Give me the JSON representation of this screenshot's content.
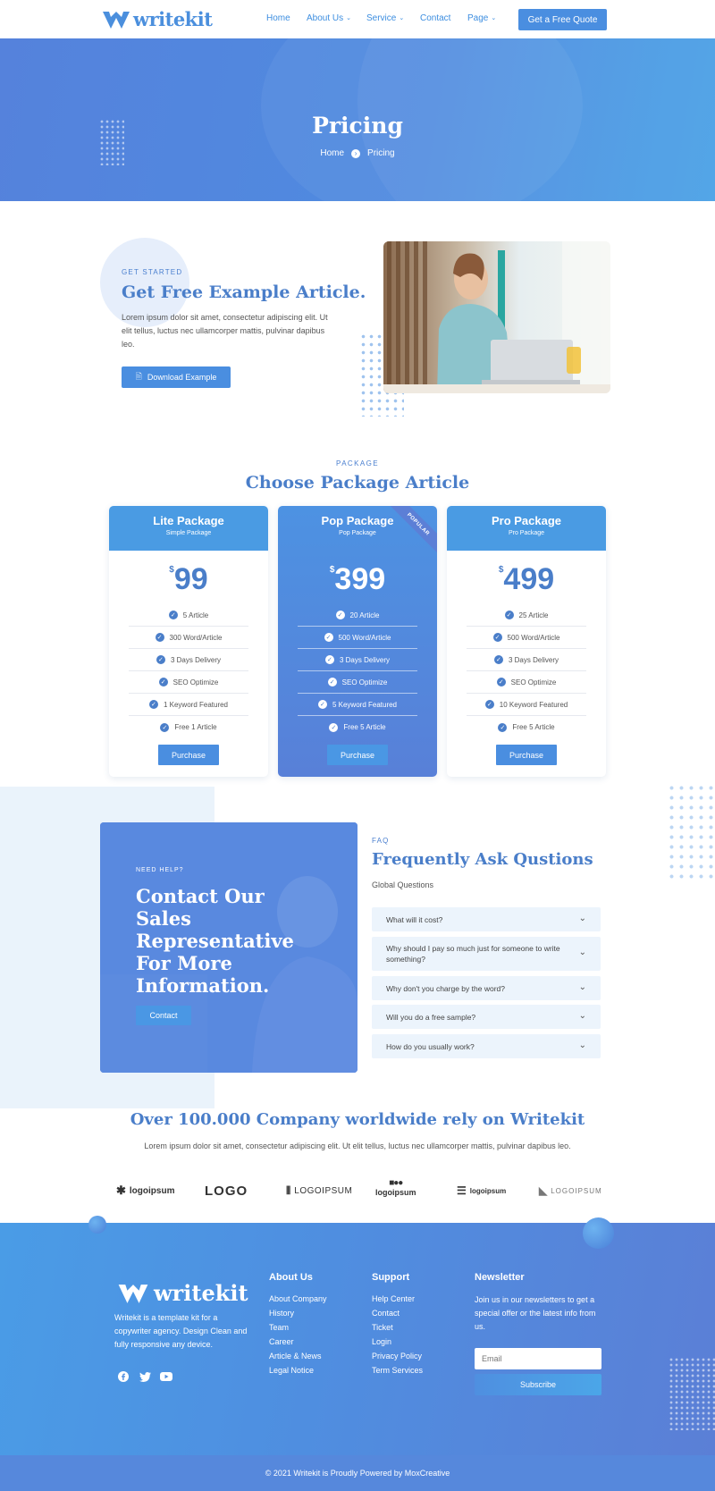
{
  "header": {
    "logo_text": "writekit",
    "nav": [
      {
        "label": "Home",
        "has_dropdown": false
      },
      {
        "label": "About Us",
        "has_dropdown": true
      },
      {
        "label": "Service",
        "has_dropdown": true
      },
      {
        "label": "Contact",
        "has_dropdown": false
      },
      {
        "label": "Page",
        "has_dropdown": true
      }
    ],
    "cta_label": "Get a Free Quote"
  },
  "hero": {
    "title": "Pricing",
    "breadcrumb": [
      "Home",
      "Pricing"
    ]
  },
  "get_started": {
    "eyebrow": "GET STARTED",
    "title": "Get Free Example Article.",
    "body": "Lorem ipsum dolor sit amet, consectetur adipiscing elit. Ut elit tellus, luctus nec ullamcorper mattis, pulvinar dapibus leo.",
    "button_label": "Download Example"
  },
  "packages": {
    "eyebrow": "PACKAGE",
    "title": "Choose Package Article",
    "currency": "$",
    "purchase_label": "Purchase",
    "popular_badge": "POPULAR",
    "items": [
      {
        "name": "Lite Package",
        "sub": "Simple Package",
        "price": "99",
        "features": [
          "5 Article",
          "300 Word/Article",
          "3 Days Delivery",
          "SEO Optimize",
          "1 Keyword Featured",
          "Free 1 Article"
        ]
      },
      {
        "name": "Pop Package",
        "sub": "Pop Package",
        "price": "399",
        "features": [
          "20 Article",
          "500 Word/Article",
          "3 Days Delivery",
          "SEO Optimize",
          "5 Keyword Featured",
          "Free 5 Article"
        ]
      },
      {
        "name": "Pro Package",
        "sub": "Pro Package",
        "price": "499",
        "features": [
          "25 Article",
          "500 Word/Article",
          "3 Days Delivery",
          "SEO Optimize",
          "10 Keyword Featured",
          "Free 5 Article"
        ]
      }
    ]
  },
  "contact": {
    "eyebrow": "NEED HELP?",
    "title": "Contact Our Sales Representative For More Information.",
    "button_label": "Contact"
  },
  "faq": {
    "eyebrow": "FAQ",
    "title": "Frequently Ask Qustions",
    "subtitle": "Global Questions",
    "items": [
      "What will it cost?",
      "Why should I pay so much just for someone to write something?",
      "Why don't you charge by the word?",
      "Will you do a free sample?",
      "How do you usually work?"
    ]
  },
  "companies": {
    "title": "Over 100.000 Company worldwide rely on Writekit",
    "body": "Lorem ipsum dolor sit amet, consectetur adipiscing elit. Ut elit tellus, luctus nec ullamcorper mattis, pulvinar dapibus leo.",
    "logos": [
      "logoipsum",
      "LOGO",
      "LOGOIPSUM",
      "logoipsum",
      "logoipsum",
      "LOGOIPSUM"
    ]
  },
  "footer": {
    "logo_text": "writekit",
    "description": "Writekit is a template kit for a copywriter agency. Design Clean and fully responsive any device.",
    "about_title": "About Us",
    "about_links": [
      "About Company",
      "History",
      "Team",
      "Career",
      "Article & News",
      "Legal Notice"
    ],
    "support_title": "Support",
    "support_links": [
      "Help Center",
      "Contact",
      "Ticket",
      "Login",
      "Privacy Policy",
      "Term Services"
    ],
    "newsletter_title": "Newsletter",
    "newsletter_text": "Join us in our newsletters to get a special offer or the latest info from us.",
    "email_placeholder": "Email",
    "subscribe_label": "Subscribe",
    "copyright": "© 2021 Writekit is Proudly Powered by MoxCreative"
  }
}
